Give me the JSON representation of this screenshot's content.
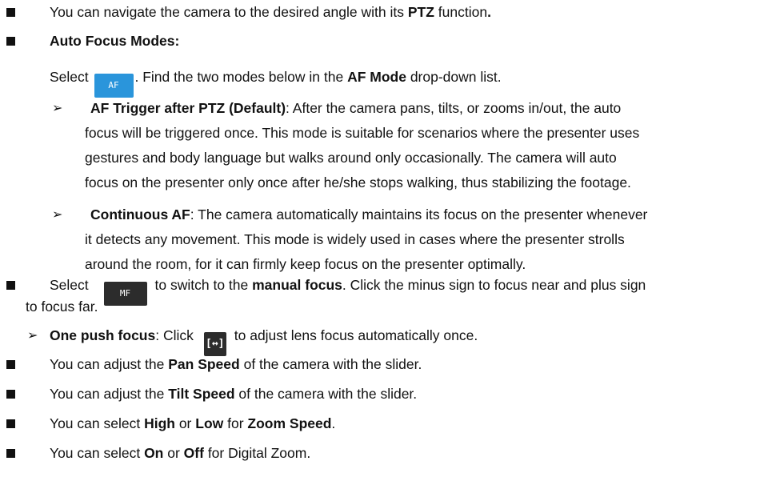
{
  "bullets": {
    "b1": {
      "pre": "You can navigate the camera to the desired angle with its ",
      "bold": "PTZ",
      "post": " function",
      "end": "."
    },
    "b2": {
      "bold": "Auto Focus Modes:"
    },
    "select_line": {
      "pre": "Select ",
      "icon": "AF",
      "post": ". Find the two modes below in the ",
      "bold": "AF Mode",
      "post2": " drop-down list."
    },
    "sub1": {
      "bold": "AF Trigger after PTZ (Default)",
      "text1": ": After the camera pans, tilts, or zooms in/out, the auto",
      "text2": "focus will be triggered once. This mode is suitable for scenarios where the presenter uses",
      "text3": "gestures and body language but walks around only occasionally. The camera will auto",
      "text4": "focus on the presenter only once after he/she stops walking, thus stabilizing the footage."
    },
    "sub2": {
      "bold": "Continuous AF",
      "text1": ": The camera automatically maintains its focus on the presenter whenever",
      "text2": "it detects any movement. This mode is widely used in cases where the presenter strolls",
      "text3": "around the room, for it can firmly keep focus on the presenter optimally."
    },
    "b3": {
      "pre": "Select",
      "icon": "MF",
      "mid": "to switch to the ",
      "bold": "manual focus",
      "post": ". Click the minus sign to focus near and plus sign",
      "cont": "to focus far."
    },
    "sub3": {
      "bold": "One push focus",
      "pre": ": Click",
      "post": "to adjust lens focus automatically once."
    },
    "b4": {
      "pre": "You can adjust the ",
      "bold": "Pan Speed",
      "post": " of the camera with the slider."
    },
    "b5": {
      "pre": "You can adjust the ",
      "bold": "Tilt Speed",
      "post": " of the camera with the slider."
    },
    "b6": {
      "pre": "You can select ",
      "bold1": "High",
      "mid1": " or ",
      "bold2": "Low",
      "mid2": " for ",
      "bold3": "Zoom Speed",
      "end": "."
    },
    "b7": {
      "pre": "You can select ",
      "bold1": "On",
      "mid1": " or ",
      "bold2": "Off",
      "post": " for Digital Zoom."
    }
  },
  "icons": {
    "bullet": "black-square",
    "sub_bullet": "arrowhead-right",
    "af_button_color": "#2a95db",
    "mf_button_color": "#2c2c2c",
    "one_push_glyph": "[↔]"
  }
}
